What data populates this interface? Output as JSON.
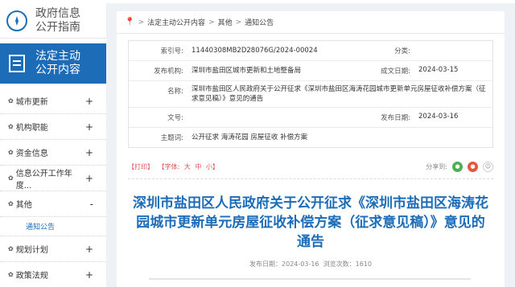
{
  "sidebar": {
    "guide_line1": "政府信息",
    "guide_line2": "公开指南",
    "active_line1": "法定主动",
    "active_line2": "公开内容",
    "items": [
      {
        "label": "城市更新",
        "sign": "+"
      },
      {
        "label": "机构职能",
        "sign": "+"
      },
      {
        "label": "资金信息",
        "sign": "+"
      },
      {
        "label": "信息公开工作年度...",
        "sign": "+"
      },
      {
        "label": "其他",
        "sign": "-"
      },
      {
        "label": "通知公告",
        "sign": ""
      },
      {
        "label": "规划计划",
        "sign": "+"
      },
      {
        "label": "政策法规",
        "sign": "+"
      }
    ]
  },
  "breadcrumb": {
    "items": [
      "法定主动公开内容",
      "其他",
      "通知公告"
    ],
    "separator": ">"
  },
  "meta": {
    "index_label": "索引号:",
    "index_value": "11440308MB2D28076G/2024-00024",
    "category_label": "分类:",
    "category_value": "",
    "publisher_label": "发布机构:",
    "publisher_value": "深圳市盐田区城市更新和土地整备局",
    "created_label": "成文日期:",
    "created_value": "2024-03-15",
    "name_label": "名称:",
    "name_value": "深圳市盐田区人民政府关于公开征求《深圳市盐田区海涛花园城市更新单元房屋征收补偿方案（征求意见稿）》意见的通告",
    "docno_label": "文号:",
    "docno_value": "",
    "pubdate_label": "发布日期:",
    "pubdate_value": "2024-03-16",
    "keywords_label": "主题词:",
    "keywords_value": "公开征求 海涛花园 房屋征收 补偿方案"
  },
  "toolbar": {
    "print": "【打印】",
    "font_prefix": "【字体:",
    "font_large": "大",
    "font_medium": "中",
    "font_small": "小】",
    "share_label": "分享到:"
  },
  "article": {
    "title": "深圳市盐田区人民政府关于公开征求《深圳市盐田区海涛花园城市更新单元房屋征收补偿方案（征求意见稿）》意见的通告",
    "pub_label": "发布日期：",
    "pub_date": "2024-03-16",
    "views_label": "浏览次数：",
    "views": "1610"
  },
  "colors": {
    "accent": "#1c6cb8",
    "toolbar_red": "#e05050"
  }
}
